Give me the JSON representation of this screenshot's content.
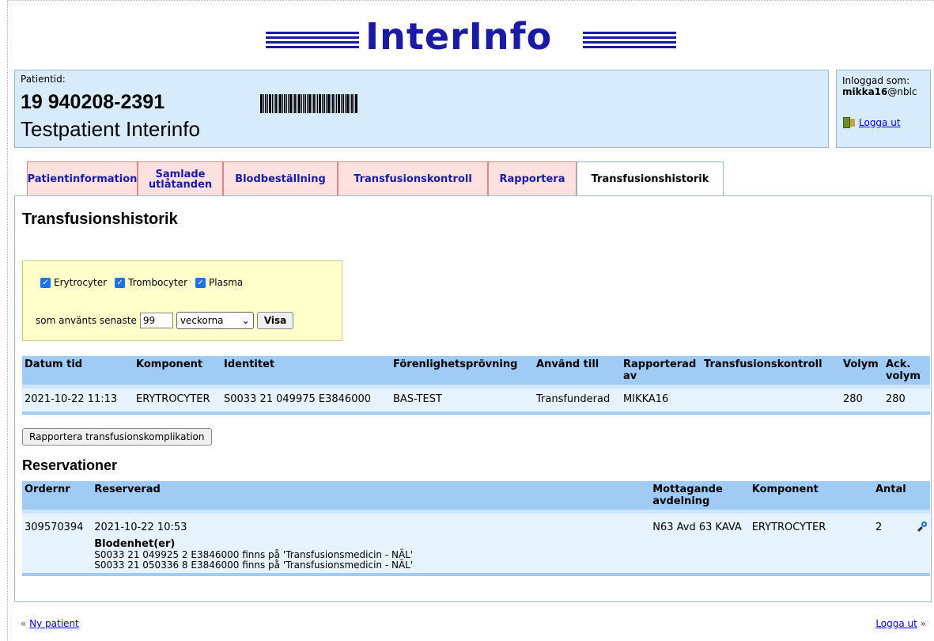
{
  "logo": {
    "text": "InterInfo"
  },
  "patient": {
    "label": "Patientid:",
    "id": "19 940208-2391",
    "name": "Testpatient Interinfo"
  },
  "login": {
    "label": "Inloggad som:",
    "user": "mikka16",
    "domain": "@nblc",
    "logout": "Logga ut"
  },
  "tabs": [
    {
      "label": "Patientinformation"
    },
    {
      "label": "Samlade utlåtanden"
    },
    {
      "label": "Blodbeställning"
    },
    {
      "label": "Transfusionskontroll"
    },
    {
      "label": "Rapportera"
    },
    {
      "label": "Transfusionshistorik",
      "active": true
    }
  ],
  "page": {
    "title": "Transfusionshistorik"
  },
  "filter": {
    "checkboxes": [
      {
        "label": "Erytrocyter",
        "checked": true
      },
      {
        "label": "Trombocyter",
        "checked": true
      },
      {
        "label": "Plasma",
        "checked": true
      }
    ],
    "range_label": "som använts senaste",
    "range_value": "99",
    "unit": "veckorna",
    "submit": "Visa"
  },
  "history": {
    "headers": [
      "Datum tid",
      "Komponent",
      "Identitet",
      "Förenlighetsprövning",
      "Använd till",
      "Rapporterad av",
      "Transfusionskontroll",
      "Volym",
      "Ack. volym"
    ],
    "rows": [
      [
        "2021-10-22 11:13",
        "ERYTROCYTER",
        "S0033 21 049975 E3846000",
        "BAS-TEST",
        "Transfunderad",
        "MIKKA16",
        "",
        "280",
        "280"
      ]
    ]
  },
  "report_button": "Rapportera transfusionskomplikation",
  "reservations": {
    "title": "Reservationer",
    "headers": [
      "Ordernr",
      "Reserverad",
      "Mottagande avdelning",
      "Komponent",
      "Antal",
      ""
    ],
    "rows": [
      {
        "ordernr": "309570394",
        "reserved": "2021-10-22 10:53",
        "department": "N63 Avd 63 KAVA",
        "component": "ERYTROCYTER",
        "count": "2",
        "units_title": "Blodenhet(er)",
        "units": [
          "S0033 21 049925 2 E3846000 finns på 'Transfusionsmedicin - NÄL'",
          "S0033 21 050336 8 E3846000 finns på 'Transfusionsmedicin - NÄL'"
        ]
      }
    ]
  },
  "footer": {
    "left": "Ny patient",
    "right": "Logga ut"
  }
}
